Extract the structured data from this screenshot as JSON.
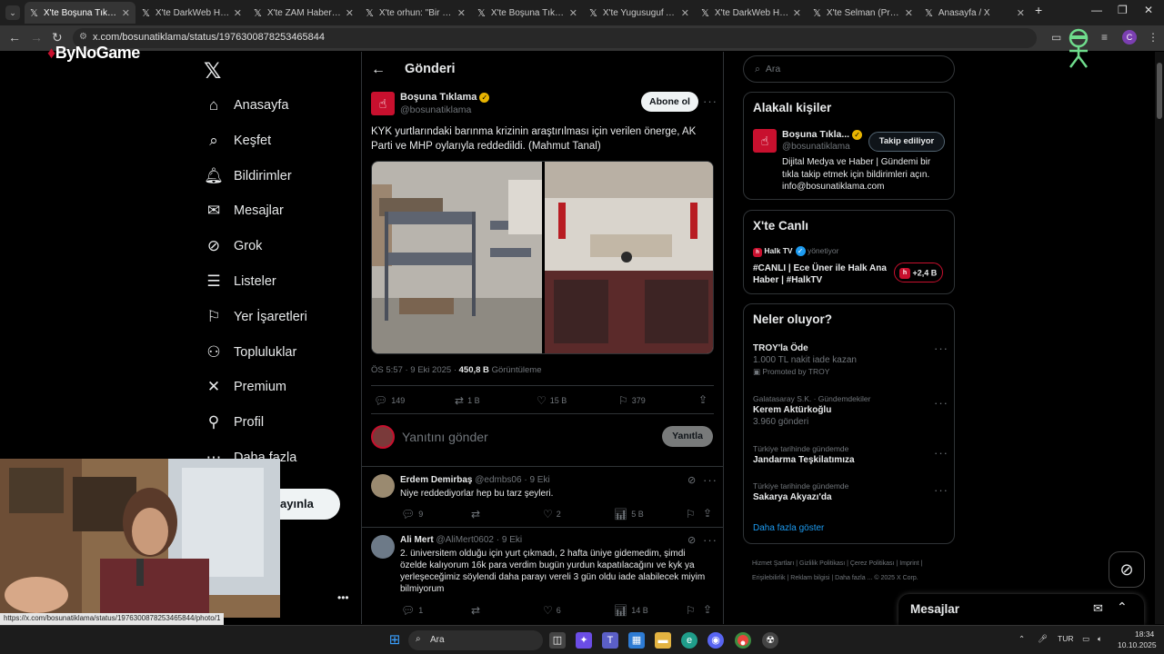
{
  "browser": {
    "tabs": [
      {
        "label": "X'te Boşuna Tıklama:",
        "active": true
      },
      {
        "label": "X'te DarkWeb Haber:",
        "active": false
      },
      {
        "label": "X'te ZAM Haber: \"Yer",
        "active": false
      },
      {
        "label": "X'te orhun: \"Bir vatan",
        "active": false
      },
      {
        "label": "X'te Boşuna Tıklama:",
        "active": false
      },
      {
        "label": "X'te Yugusuguf Arşiv",
        "active": false
      },
      {
        "label": "X'te DarkWeb Haber:",
        "active": false
      },
      {
        "label": "X'te Selman (Prens o",
        "active": false
      },
      {
        "label": "Anasayfa / X",
        "active": false
      }
    ],
    "url": "x.com/bosunatiklama/status/1976300878253465844",
    "profile_initial": "C"
  },
  "overlay": {
    "brand": "ByNoGame",
    "status_link": "https://x.com/bosunatiklama/status/1976300878253465844/photo/1"
  },
  "sidebar": {
    "items": [
      {
        "label": "Anasayfa",
        "icon": "home-icon",
        "glyph": "⌂"
      },
      {
        "label": "Keşfet",
        "icon": "search-icon",
        "glyph": "⌕"
      },
      {
        "label": "Bildirimler",
        "icon": "bell-icon",
        "glyph": "🔔︎"
      },
      {
        "label": "Mesajlar",
        "icon": "envelope-icon",
        "glyph": "✉"
      },
      {
        "label": "Grok",
        "icon": "grok-icon",
        "glyph": "⊘"
      },
      {
        "label": "Listeler",
        "icon": "list-icon",
        "glyph": "☰"
      },
      {
        "label": "Yer İşaretleri",
        "icon": "bookmark-icon",
        "glyph": "⚐"
      },
      {
        "label": "Topluluklar",
        "icon": "people-icon",
        "glyph": "⚇"
      },
      {
        "label": "Premium",
        "icon": "x-icon",
        "glyph": "✕"
      },
      {
        "label": "Profil",
        "icon": "person-icon",
        "glyph": "⚲"
      },
      {
        "label": "Daha fazla",
        "icon": "more-icon",
        "glyph": "⋯"
      }
    ],
    "post_label": "ayınla"
  },
  "main": {
    "header_title": "Gönderi",
    "tweet": {
      "name": "Boşuna Tıklama",
      "handle": "@bosunatiklama",
      "follow_label": "Abone ol",
      "text": "KYK yurtlarındaki barınma krizinin araştırılması için verilen önerge, AK Parti ve MHP oylarıyla reddedildi. (Mahmut Tanal)",
      "time": "ÖS 5:57 · 9 Eki 2025 ·",
      "views": "450,8 B",
      "views_label": "Görüntüleme",
      "stats": {
        "replies": "149",
        "retweets": "1 B",
        "likes": "15 B",
        "bookmarks": "379"
      }
    },
    "reply_box": {
      "placeholder": "Yanıtını gönder",
      "button": "Yanıtla"
    },
    "comments": [
      {
        "name": "Erdem Demirbaş",
        "handle": "@edmbs06",
        "date": "· 9 Eki",
        "text": "Niye reddediyorlar hep bu tarz şeyleri.",
        "replies": "9",
        "retweets": "",
        "likes": "2",
        "views": "5 B"
      },
      {
        "name": "Ali Mert",
        "handle": "@AliMert0602",
        "date": "· 9 Eki",
        "text": "2. üniversitem  olduğu için yurt çıkmadı, 2 hafta üniye gidemedim, şimdi özelde kalıyorum 16k para verdim bugün yurdun kapatılacağını ve kyk ya yerleşeceğimiz söylendi daha parayı vereli 3 gün oldu iade alabilecek miyim bilmiyorum",
        "replies": "1",
        "retweets": "",
        "likes": "6",
        "views": "14 B"
      }
    ]
  },
  "right": {
    "search_placeholder": "Ara",
    "related": {
      "title": "Alakalı kişiler",
      "name": "Boşuna Tıkla...",
      "handle": "@bosunatiklama",
      "button": "Takip ediliyor",
      "bio": "Dijital Medya ve Haber | Gündemi bir tıkla takip etmek için bildirimleri açın. info@bosunatiklama.com"
    },
    "live": {
      "title": "X'te Canlı",
      "host": "Halk TV",
      "host_suffix": "yönetiyor",
      "text": "#CANLI | Ece Üner ile Halk Ana Haber | #HalkTV",
      "listeners": "+2,4 B"
    },
    "trends": {
      "title": "Neler oluyor?",
      "items": [
        {
          "category": "",
          "name": "TROY'la Öde",
          "sub": "1.000 TL nakit iade kazan",
          "extra": "Promoted by TROY"
        },
        {
          "category": "Galatasaray S.K. · Gündemdekiler",
          "name": "Kerem Aktürkoğlu",
          "sub": "3.960 gönderi",
          "extra": ""
        },
        {
          "category": "Türkiye tarihinde gündemde",
          "name": "Jandarma Teşkilatımıza",
          "sub": "",
          "extra": ""
        },
        {
          "category": "Türkiye tarihinde gündemde",
          "name": "Sakarya Akyazı'da",
          "sub": "",
          "extra": ""
        }
      ],
      "more": "Daha fazla göster"
    },
    "footer": "Hizmet Şartları  |  Gizlilik Politikası  |  Çerez Politikası  |  Imprint  |  Erişilebilirlik  |  Reklam bilgisi  |  Daha fazla ...  © 2025 X Corp.",
    "messages_title": "Mesajlar"
  },
  "taskbar": {
    "search": "Ara",
    "lang": "TUR",
    "time": "18:34",
    "date": "10.10.2025"
  },
  "colors": {
    "accent_red": "#c8102e",
    "verified_gold": "#e8b400",
    "verified_blue": "#1d9bf0",
    "link_blue": "#1d9bf0"
  }
}
